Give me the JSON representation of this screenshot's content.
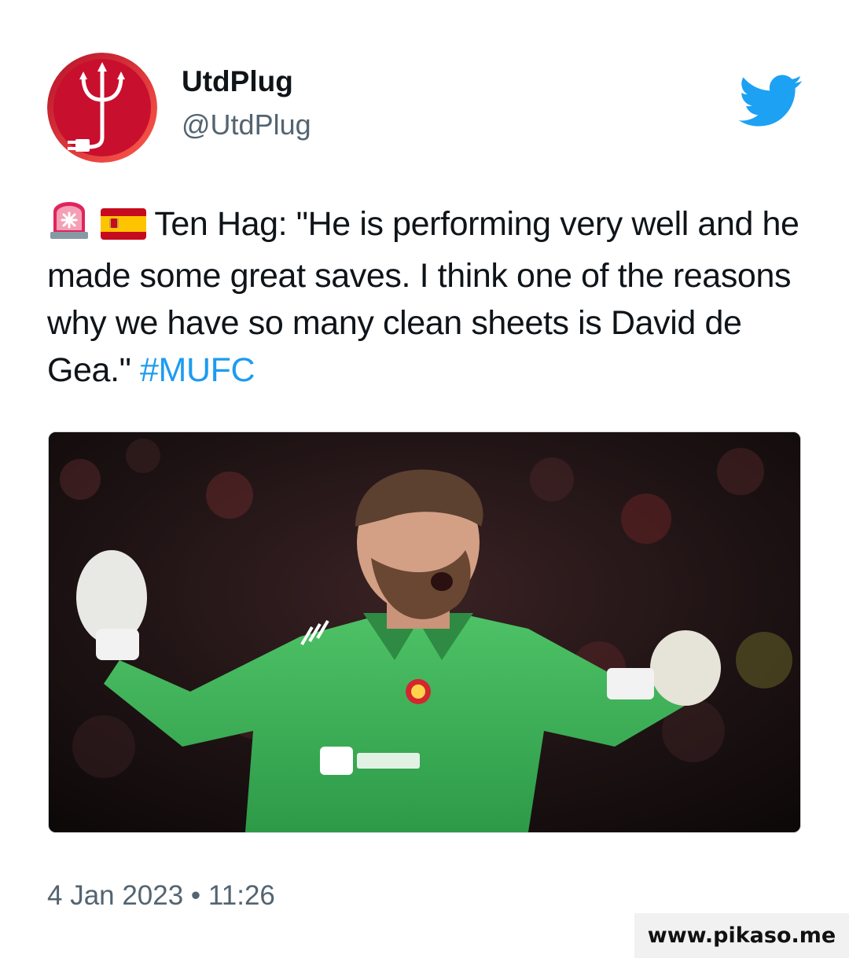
{
  "author": {
    "display_name": "UtdPlug",
    "handle": "@UtdPlug",
    "avatar_icon": "trident-plug-logo"
  },
  "brand_icon": "twitter-bird-icon",
  "tweet": {
    "emojis": [
      "police-light-emoji",
      "spain-flag-emoji"
    ],
    "text": " Ten Hag: \"He is performing very well and he made some great saves. I think one of the reasons why we have so many clean sheets is David de Gea.\" ",
    "hashtag": "#MUFC",
    "media_description": "photo"
  },
  "timestamp": "4 Jan 2023 • 11:26",
  "watermark": "www.pikaso.me",
  "colors": {
    "hashtag": "#1d9bf0",
    "twitter_blue": "#1da1f2",
    "avatar_red": "#c8102e",
    "secondary_text": "#536471"
  }
}
